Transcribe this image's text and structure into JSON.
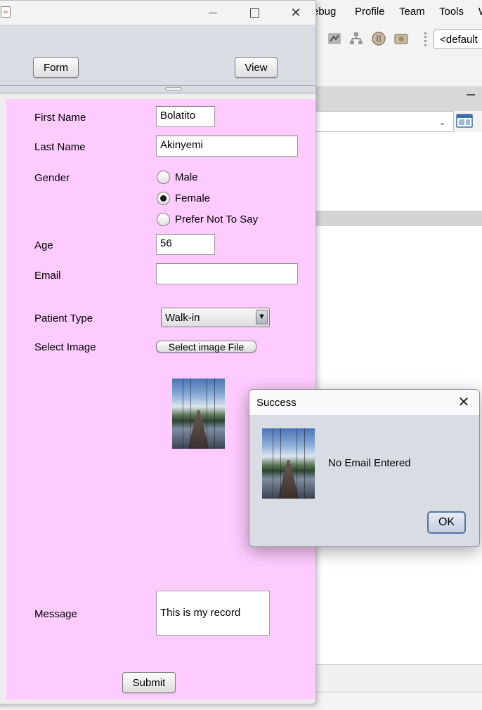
{
  "ide": {
    "menu": [
      "ebug",
      "Profile",
      "Team",
      "Tools",
      "W"
    ],
    "toolbar_combo_value": "<default",
    "toolbar_icons": [
      "build-icon",
      "profile-icon",
      "hierarchy-icon",
      "record-icon",
      "snapshot-icon"
    ]
  },
  "window": {
    "controls": {
      "minimize": "minimize",
      "maximize": "maximize",
      "close": "✕"
    }
  },
  "top_panel": {
    "form_button": "Form",
    "view_button": "View"
  },
  "form": {
    "first_name": {
      "label": "First Name",
      "value": "Bolatito"
    },
    "last_name": {
      "label": "Last Name",
      "value": "Akinyemi"
    },
    "gender": {
      "label": "Gender",
      "options": [
        "Male",
        "Female",
        "Prefer Not To Say"
      ],
      "selected": "Female"
    },
    "age": {
      "label": "Age",
      "value": "56"
    },
    "email": {
      "label": "Email",
      "value": ""
    },
    "patient_type": {
      "label": "Patient Type",
      "selected": "Walk-in"
    },
    "select_image": {
      "label": "Select Image",
      "button": "Select image File"
    },
    "message": {
      "label": "Message",
      "value": "This is my record"
    },
    "submit_label": "Submit"
  },
  "dialog": {
    "title": "Success",
    "message": "No Email Entered",
    "ok_label": "OK"
  },
  "colors": {
    "form_background": "#fecbfe",
    "top_panel_background": "#d9dce2",
    "dialog_background": "#d8dce3"
  }
}
